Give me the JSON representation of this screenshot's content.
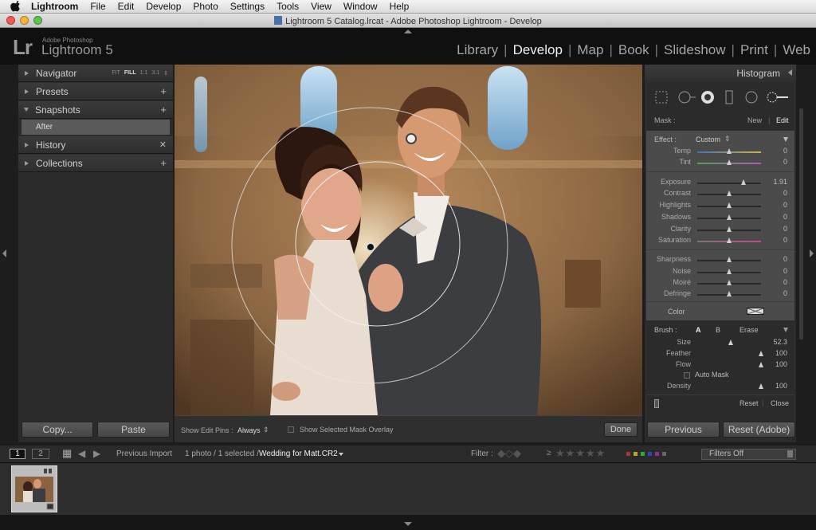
{
  "menubar": {
    "app": "Lightroom",
    "items": [
      "File",
      "Edit",
      "Develop",
      "Photo",
      "Settings",
      "Tools",
      "View",
      "Window",
      "Help"
    ]
  },
  "window": {
    "title": "Lightroom 5 Catalog.lrcat - Adobe Photoshop Lightroom - Develop"
  },
  "identity": {
    "logo": "Lr",
    "brand": "Adobe Photoshop",
    "product": "Lightroom 5"
  },
  "modules": [
    "Library",
    "Develop",
    "Map",
    "Book",
    "Slideshow",
    "Print",
    "Web"
  ],
  "left_panel": {
    "navigator": "Navigator",
    "nav_fit": "FIT",
    "nav_fill": "FILL",
    "nav_1to1": "1:1",
    "nav_3to1": "3:1",
    "presets": "Presets",
    "snapshots": "Snapshots",
    "snapshot_item": "After",
    "history": "History",
    "collections": "Collections",
    "copy_button": "Copy...",
    "paste_button": "Paste"
  },
  "toolbar": {
    "show_pins_label": "Show Edit Pins :",
    "show_pins_value": "Always",
    "mask_overlay": "Show Selected Mask Overlay",
    "done": "Done"
  },
  "right_panel": {
    "histogram": "Histogram",
    "mask_label": "Mask :",
    "mask_new": "New",
    "mask_edit": "Edit",
    "effect_label": "Effect :",
    "effect_value": "Custom",
    "sliders_wb": [
      {
        "label": "Temp",
        "value": "0",
        "pos": 0.5
      },
      {
        "label": "Tint",
        "value": "0",
        "pos": 0.5
      }
    ],
    "sliders_tone": [
      {
        "label": "Exposure",
        "value": "1.91",
        "pos": 0.72
      },
      {
        "label": "Contrast",
        "value": "0",
        "pos": 0.5
      },
      {
        "label": "Highlights",
        "value": "0",
        "pos": 0.5
      },
      {
        "label": "Shadows",
        "value": "0",
        "pos": 0.5
      },
      {
        "label": "Clarity",
        "value": "0",
        "pos": 0.5
      },
      {
        "label": "Saturation",
        "value": "0",
        "pos": 0.5
      }
    ],
    "sliders_detail": [
      {
        "label": "Sharpness",
        "value": "0",
        "pos": 0.5
      },
      {
        "label": "Noise",
        "value": "0",
        "pos": 0.5
      },
      {
        "label": "Moiré",
        "value": "0",
        "pos": 0.5
      },
      {
        "label": "Defringe",
        "value": "0",
        "pos": 0.5
      }
    ],
    "color_label": "Color",
    "brush_label": "Brush :",
    "brush_a": "A",
    "brush_b": "B",
    "brush_erase": "Erase",
    "sliders_brush": [
      {
        "label": "Size",
        "value": "52.3",
        "pos": 0.52
      },
      {
        "label": "Feather",
        "value": "100",
        "pos": 1.0
      },
      {
        "label": "Flow",
        "value": "100",
        "pos": 1.0
      }
    ],
    "auto_mask": "Auto Mask",
    "density_label": "Density",
    "density_value": "100",
    "density_pos": 1.0,
    "reset": "Reset",
    "close": "Close",
    "previous_button": "Previous",
    "reset_adobe_button": "Reset (Adobe)"
  },
  "filmstrip_bar": {
    "view1": "1",
    "view2": "2",
    "source": "Previous Import",
    "count": "1 photo / 1 selected /",
    "filename": "Wedding for Matt.CR2",
    "filter_label": "Filter :",
    "filters_off": "Filters Off"
  },
  "colors": {
    "accent": "#f0f0f0",
    "panel": "#2b2b2b",
    "highlight_panel": "#4b4b4b"
  }
}
